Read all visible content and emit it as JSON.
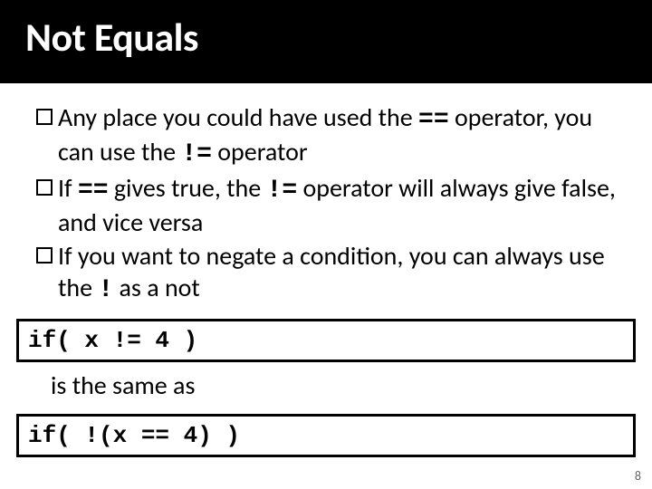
{
  "header": {
    "title": "Not Equals"
  },
  "bullets": [
    {
      "pre": "Any place you could have used the ",
      "code1": "==",
      "mid1": " operator, you can use the ",
      "code2": "!=",
      "post": " operator"
    },
    {
      "pre": "If ",
      "code1": "==",
      "mid1": " gives true, the ",
      "code2": "!=",
      "post": " operator will always give false, and vice versa"
    },
    {
      "pre": "If you want to negate a condition, you can always use the ",
      "code1": "!",
      "mid1": "",
      "code2": "",
      "post": " as a not"
    }
  ],
  "code_example_1": "if( x != 4 )",
  "between": "is the same as",
  "code_example_2": "if( !(x == 4) )",
  "page_number": "8"
}
